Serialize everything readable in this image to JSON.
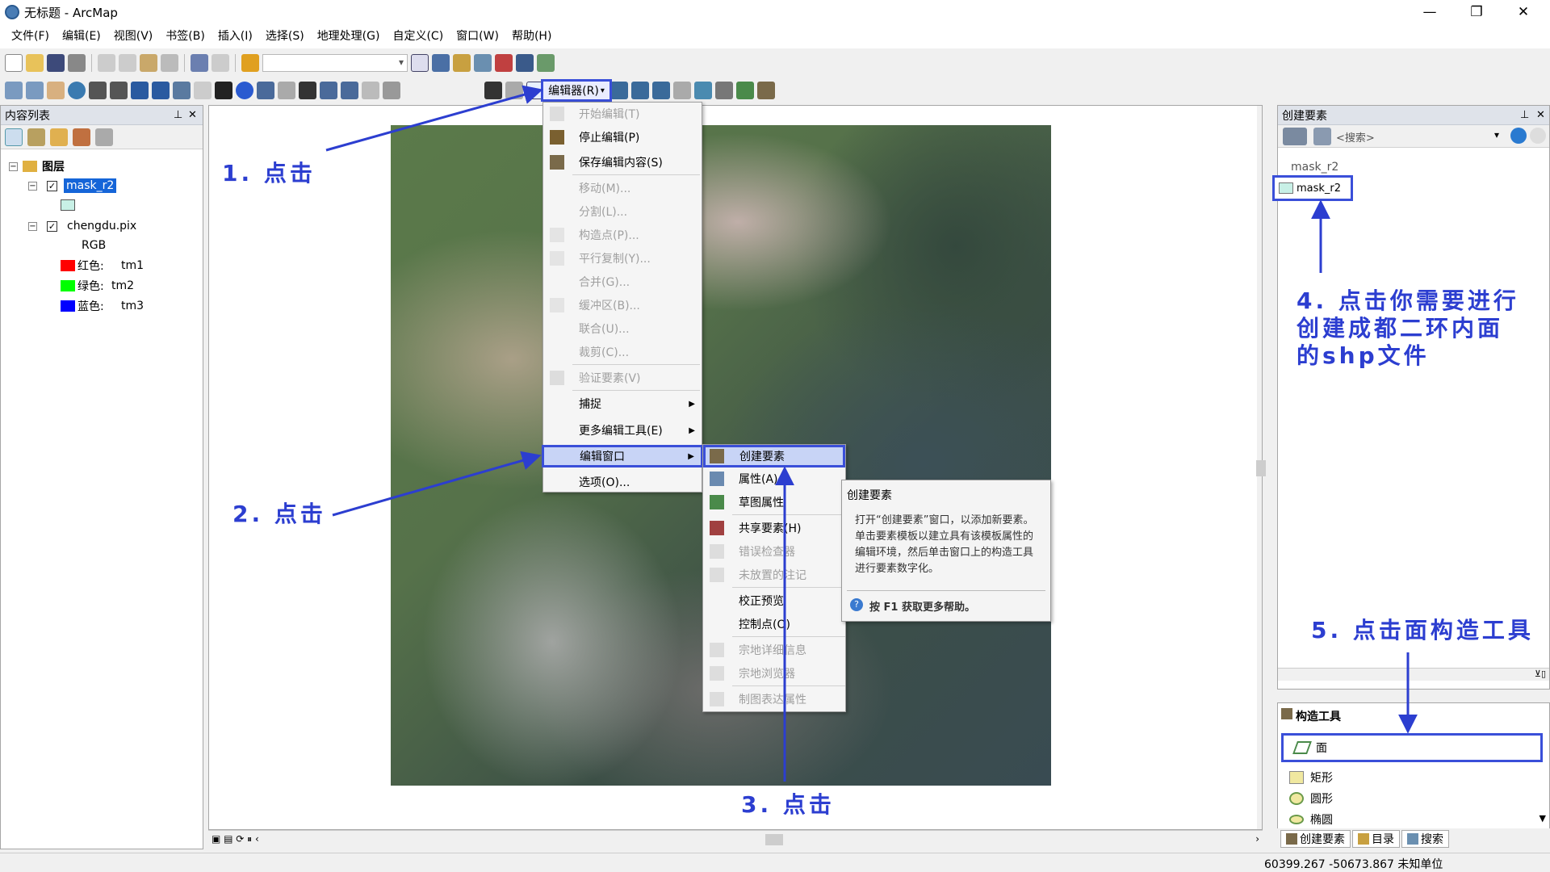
{
  "window": {
    "title": "无标题 - ArcMap"
  },
  "menubar": [
    "文件(F)",
    "编辑(E)",
    "视图(V)",
    "书签(B)",
    "插入(I)",
    "选择(S)",
    "地理处理(G)",
    "自定义(C)",
    "窗口(W)",
    "帮助(H)"
  ],
  "editor_button": "编辑器(R)",
  "toc": {
    "title": "内容列表",
    "root": "图层",
    "layer1": "mask_r2",
    "layer2": "chengdu.pix",
    "rgb": "RGB",
    "bands": [
      {
        "label": "红色:",
        "band": "tm1",
        "color": "#ff0000"
      },
      {
        "label": "绿色:",
        "band": "tm2",
        "color": "#00ff00"
      },
      {
        "label": "蓝色:",
        "band": "tm3",
        "color": "#0000ff"
      }
    ]
  },
  "editor_menu": [
    {
      "label": "开始编辑(T)",
      "disabled": true
    },
    {
      "label": "停止编辑(P)",
      "disabled": false
    },
    {
      "label": "保存编辑内容(S)",
      "disabled": false
    },
    {
      "label": "移动(M)...",
      "disabled": true
    },
    {
      "label": "分割(L)...",
      "disabled": true
    },
    {
      "label": "构造点(P)...",
      "disabled": true
    },
    {
      "label": "平行复制(Y)...",
      "disabled": true
    },
    {
      "label": "合并(G)...",
      "disabled": true
    },
    {
      "label": "缓冲区(B)...",
      "disabled": true
    },
    {
      "label": "联合(U)...",
      "disabled": true
    },
    {
      "label": "裁剪(C)...",
      "disabled": true
    },
    {
      "label": "验证要素(V)",
      "disabled": true
    },
    {
      "label": "捕捉",
      "disabled": false
    },
    {
      "label": "更多编辑工具(E)",
      "disabled": false
    },
    {
      "label": "编辑窗口",
      "disabled": false
    },
    {
      "label": "选项(O)...",
      "disabled": false
    }
  ],
  "submenu": [
    {
      "label": "创建要素",
      "disabled": false
    },
    {
      "label": "属性(A)",
      "disabled": false
    },
    {
      "label": "草图属性",
      "disabled": false
    },
    {
      "label": "共享要素(H)",
      "disabled": false
    },
    {
      "label": "错误检查器",
      "disabled": true
    },
    {
      "label": "未放置的注记",
      "disabled": true
    },
    {
      "label": "校正预览",
      "disabled": false
    },
    {
      "label": "控制点(O)",
      "disabled": false
    },
    {
      "label": "宗地详细信息",
      "disabled": true
    },
    {
      "label": "宗地浏览器",
      "disabled": true
    },
    {
      "label": "制图表达属性",
      "disabled": true
    }
  ],
  "tooltip": {
    "title": "创建要素",
    "body": "打开“创建要素”窗口，以添加新要素。单击要素模板以建立具有该模板属性的编辑环境，然后单击窗口上的构造工具进行要素数字化。",
    "help": "按 F1 获取更多帮助。"
  },
  "create_panel": {
    "title": "创建要素",
    "search_placeholder": "<搜索>",
    "group": "mask_r2",
    "template": "mask_r2"
  },
  "construct_panel": {
    "title": "构造工具",
    "tools": [
      "面",
      "矩形",
      "圆形",
      "椭圆"
    ]
  },
  "bottom_tabs": [
    "创建要素",
    "目录",
    "搜索"
  ],
  "status": {
    "coords": "60399.267  -50673.867 未知单位"
  },
  "annotations": {
    "a1": "1. 点击",
    "a2": "2. 点击",
    "a3": "3. 点击",
    "a4": "4. 点击你需要进行\n创建成都二环内面\n的shp文件",
    "a5": "5. 点击面构造工具"
  },
  "colors": {
    "annotation": "#2c3ed0",
    "highlight": "#3a4fd9"
  }
}
